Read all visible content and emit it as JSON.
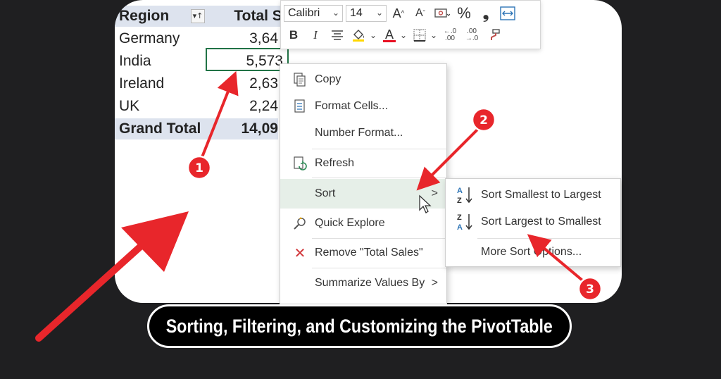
{
  "pivot": {
    "header": {
      "region": "Region",
      "total": "Total Sale"
    },
    "rows": [
      {
        "region": "Germany",
        "total": "3,64"
      },
      {
        "region": "India",
        "total": "5,573"
      },
      {
        "region": "Ireland",
        "total": "2,63"
      },
      {
        "region": "UK",
        "total": "2,24"
      }
    ],
    "grand_total": {
      "region": "Grand Total",
      "total": "14,09"
    },
    "filter_icon": "sort-filter-icon"
  },
  "toolbar": {
    "font": "Calibri",
    "size": "14",
    "buttons_row1": [
      "increase-font-icon",
      "decrease-font-icon",
      "currency-format-icon",
      "percent-style-icon",
      "comma-style-icon",
      "merge-center-icon"
    ],
    "buttons_row2": [
      "bold-icon",
      "italic-icon",
      "align-center-icon",
      "fill-color-icon",
      "font-color-icon",
      "borders-icon",
      "increase-decimal-icon",
      "decrease-decimal-icon",
      "format-painter-icon"
    ],
    "bold": "B",
    "italic": "I",
    "percent": "%",
    "comma": "❟",
    "increase_font": "A^",
    "decrease_font": "Aˇ",
    "font_color_letter": "A",
    "font_color_accent": "#e81123"
  },
  "context_menu": {
    "items": [
      {
        "label": "Copy",
        "icon": "copy-icon"
      },
      {
        "label": "Format Cells...",
        "icon": "format-cells-icon"
      },
      {
        "label": "Number Format...",
        "icon": ""
      },
      {
        "label": "Refresh",
        "icon": "refresh-icon"
      },
      {
        "label": "Sort",
        "icon": "",
        "submenu": true
      },
      {
        "label": "Quick Explore",
        "icon": "quick-explore-icon"
      },
      {
        "label": "Remove \"Total Sales\"",
        "icon": "remove-icon"
      },
      {
        "label": "Summarize Values By",
        "icon": "",
        "submenu": true
      }
    ],
    "hover_color": "#e6efe8"
  },
  "sort_submenu": {
    "items": [
      {
        "label": "Sort Smallest to Largest",
        "icon": "sort-ascending-icon"
      },
      {
        "label": "Sort Largest to Smallest",
        "icon": "sort-descending-icon"
      },
      {
        "label": "More Sort Options...",
        "icon": ""
      }
    ]
  },
  "callouts": [
    "1",
    "2",
    "3"
  ],
  "annotation_color": "#e8262b",
  "banner": {
    "title": "Sorting, Filtering, and Customizing the PivotTable"
  }
}
